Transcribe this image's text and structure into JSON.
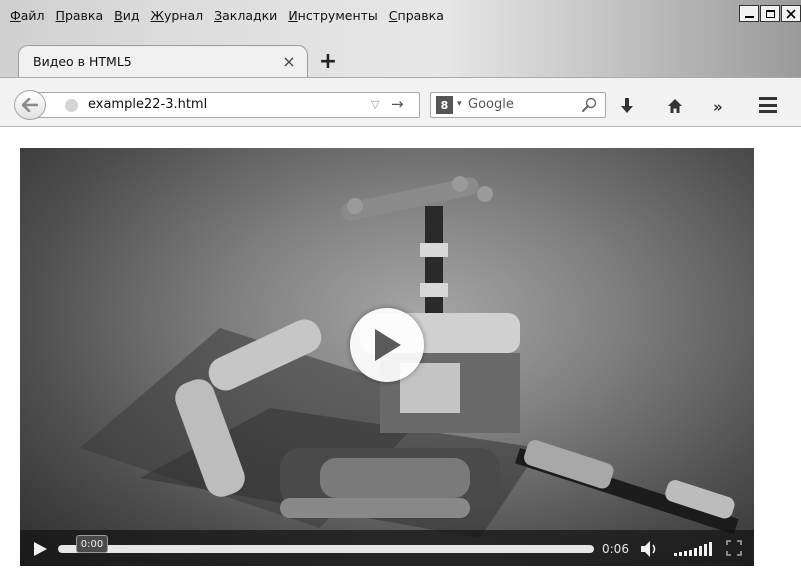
{
  "menubar": {
    "items": [
      {
        "first": "Ф",
        "rest": "айл"
      },
      {
        "first": "П",
        "rest": "равка"
      },
      {
        "first": "В",
        "rest": "ид"
      },
      {
        "first": "Ж",
        "rest": "урнал"
      },
      {
        "first": "З",
        "rest": "акладки"
      },
      {
        "first": "И",
        "rest": "нструменты"
      },
      {
        "first": "С",
        "rest": "правка"
      }
    ]
  },
  "tab": {
    "title": "Видео в HTML5",
    "close_symbol": "×"
  },
  "new_tab_symbol": "+",
  "urlbar": {
    "value": "example22-3.html",
    "dropdown_symbol": "▽",
    "go_symbol": "→"
  },
  "searchbar": {
    "engine_badge": "8",
    "engine_dropdown_symbol": "▾",
    "placeholder": "Google"
  },
  "toolbar": {
    "overflow_symbol": "»"
  },
  "video": {
    "current_time": "0:00",
    "duration": "0:06",
    "progress": 0.0,
    "volume_level": 1.0
  },
  "colors": {
    "chrome_gray": "#f2f2f2",
    "video_controls_bg": "#1e1e1e",
    "progress_fill": "#e6e6e6"
  },
  "icons": [
    "back-arrow-icon",
    "globe-icon",
    "search-icon",
    "download-arrow-icon",
    "home-icon",
    "hamburger-menu-icon",
    "play-icon",
    "speaker-icon",
    "fullscreen-icon"
  ]
}
